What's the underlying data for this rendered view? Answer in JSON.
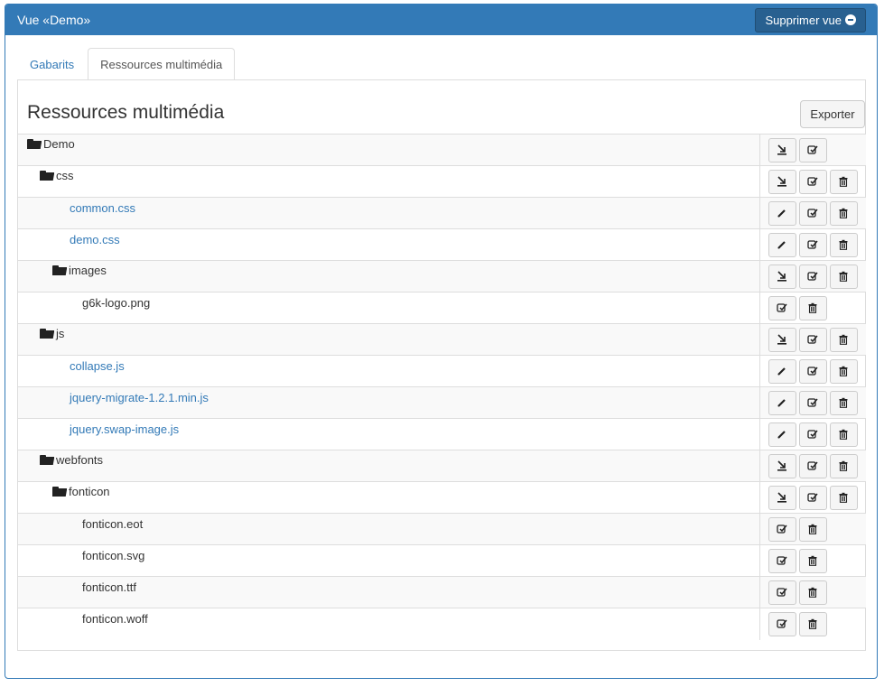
{
  "header": {
    "title": "Vue «Demo»",
    "delete_view_label": "Supprimer vue"
  },
  "tabs": [
    {
      "label": "Gabarits",
      "active": false
    },
    {
      "label": "Ressources multimédia",
      "active": true
    }
  ],
  "section": {
    "title": "Ressources multimédia",
    "export_label": "Exporter"
  },
  "tree": [
    {
      "name": "Demo",
      "type": "folder",
      "level": 0,
      "actions": [
        "download",
        "rename"
      ]
    },
    {
      "name": "css",
      "type": "folder",
      "level": 1,
      "actions": [
        "download",
        "rename",
        "delete"
      ]
    },
    {
      "name": "common.css",
      "type": "file-editable",
      "level": 2,
      "actions": [
        "edit",
        "rename",
        "delete"
      ]
    },
    {
      "name": "demo.css",
      "type": "file-editable",
      "level": 2,
      "actions": [
        "edit",
        "rename",
        "delete"
      ]
    },
    {
      "name": "images",
      "type": "folder",
      "level": 2,
      "actions": [
        "download",
        "rename",
        "delete"
      ]
    },
    {
      "name": "g6k-logo.png",
      "type": "file",
      "level": 3,
      "actions": [
        "rename",
        "delete"
      ]
    },
    {
      "name": "js",
      "type": "folder",
      "level": 1,
      "actions": [
        "download",
        "rename",
        "delete"
      ]
    },
    {
      "name": "collapse.js",
      "type": "file-editable",
      "level": 2,
      "actions": [
        "edit",
        "rename",
        "delete"
      ]
    },
    {
      "name": "jquery-migrate-1.2.1.min.js",
      "type": "file-editable",
      "level": 2,
      "actions": [
        "edit",
        "rename",
        "delete"
      ]
    },
    {
      "name": "jquery.swap-image.js",
      "type": "file-editable",
      "level": 2,
      "actions": [
        "edit",
        "rename",
        "delete"
      ]
    },
    {
      "name": "webfonts",
      "type": "folder",
      "level": 1,
      "actions": [
        "download",
        "rename",
        "delete"
      ]
    },
    {
      "name": "fonticon",
      "type": "folder",
      "level": 2,
      "actions": [
        "download",
        "rename",
        "delete"
      ]
    },
    {
      "name": "fonticon.eot",
      "type": "file",
      "level": 3,
      "actions": [
        "rename",
        "delete"
      ]
    },
    {
      "name": "fonticon.svg",
      "type": "file",
      "level": 3,
      "actions": [
        "rename",
        "delete"
      ]
    },
    {
      "name": "fonticon.ttf",
      "type": "file",
      "level": 3,
      "actions": [
        "rename",
        "delete"
      ]
    },
    {
      "name": "fonticon.woff",
      "type": "file",
      "level": 3,
      "actions": [
        "rename",
        "delete"
      ]
    }
  ]
}
